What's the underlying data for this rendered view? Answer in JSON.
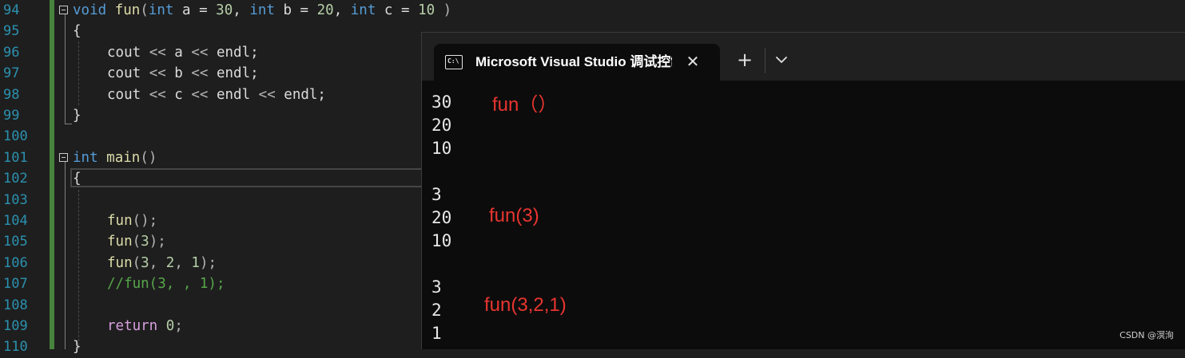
{
  "editor": {
    "line_numbers": [
      "94",
      "95",
      "96",
      "97",
      "98",
      "99",
      "100",
      "101",
      "102",
      "103",
      "104",
      "105",
      "106",
      "107",
      "108",
      "109",
      "110"
    ],
    "code": {
      "l94": {
        "t1": "void",
        "t2": "fun",
        "t3": "(",
        "t4": "int",
        "t5": " a = ",
        "t6": "30",
        "t7": ", ",
        "t8": "int",
        "t9": " b = ",
        "t10": "20",
        "t11": ", ",
        "t12": "int",
        "t13": " c = ",
        "t14": "10",
        "t15": " )"
      },
      "l95": "{",
      "l96": {
        "a": "cout ",
        "b": "<<",
        "c": " a ",
        "d": "<<",
        "e": " endl;"
      },
      "l97": {
        "a": "cout ",
        "b": "<<",
        "c": " b ",
        "d": "<<",
        "e": " endl;"
      },
      "l98": {
        "a": "cout ",
        "b": "<<",
        "c": " c ",
        "d": "<<",
        "e": " endl ",
        "f": "<<",
        "g": " endl;"
      },
      "l99": "}",
      "l101": {
        "a": "int",
        "b": " ",
        "c": "main",
        "d": "()"
      },
      "l102": "{",
      "l104": {
        "a": "fun",
        "b": "();"
      },
      "l105": {
        "a": "fun",
        "b": "(",
        "c": "3",
        "d": ");"
      },
      "l106": {
        "a": "fun",
        "b": "(",
        "c": "3",
        "d": ", ",
        "e": "2",
        "f": ", ",
        "g": "1",
        "h": ");"
      },
      "l107": "//fun(3, , 1);",
      "l109": {
        "a": "return",
        "b": " ",
        "c": "0",
        "d": ";"
      },
      "l110": "}"
    }
  },
  "terminal": {
    "tab_title": "Microsoft Visual Studio 调试控制台",
    "tab_icon_text": "C:\\",
    "close_glyph": "✕",
    "new_tab_glyph": "+",
    "output": [
      "30",
      "20",
      "10",
      "",
      "3",
      "20",
      "10",
      "",
      "3",
      "2",
      "1"
    ],
    "annotations": [
      "fun（）",
      "fun(3)",
      "fun(3,2,1)"
    ]
  },
  "watermark": "CSDN @溟洵",
  "colors": {
    "annotation": "#e8352f",
    "keyword": "#569cd6",
    "function": "#dcdcaa",
    "number": "#b5cea8",
    "comment": "#57a64a",
    "line_number": "#2b91af"
  }
}
